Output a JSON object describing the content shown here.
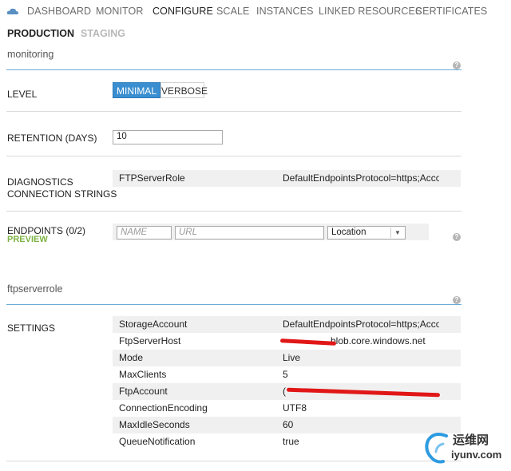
{
  "nav": {
    "items": [
      {
        "label": "DASHBOARD"
      },
      {
        "label": "MONITOR"
      },
      {
        "label": "CONFIGURE"
      },
      {
        "label": "SCALE"
      },
      {
        "label": "INSTANCES"
      },
      {
        "label": "LINKED RESOURCES"
      },
      {
        "label": "CERTIFICATES"
      }
    ],
    "active": "CONFIGURE"
  },
  "environments": {
    "production": "PRODUCTION",
    "staging": "STAGING"
  },
  "monitoring": {
    "title": "monitoring",
    "level": {
      "label": "LEVEL",
      "options": [
        "MINIMAL",
        "VERBOSE"
      ],
      "selected": "MINIMAL"
    },
    "retention": {
      "label": "RETENTION (DAYS)",
      "value": "10"
    },
    "diagnostics": {
      "label_line1": "DIAGNOSTICS",
      "label_line2": "CONNECTION STRINGS",
      "role": "FTPServerRole",
      "value": "DefaultEndpointsProtocol=https;Acco"
    },
    "endpoints": {
      "label": "ENDPOINTS (0/2)",
      "preview": "PREVIEW",
      "name_placeholder": "NAME",
      "url_placeholder": "URL",
      "location": "Location"
    }
  },
  "role": {
    "title": "ftpserverrole",
    "settings_label": "SETTINGS",
    "settings": [
      {
        "key": "StorageAccount",
        "value": "DefaultEndpointsProtocol=https;Acco"
      },
      {
        "key": "FtpServerHost",
        "value": "blob.core.windows.net"
      },
      {
        "key": "Mode",
        "value": "Live"
      },
      {
        "key": "MaxClients",
        "value": "5"
      },
      {
        "key": "FtpAccount",
        "value": "("
      },
      {
        "key": "ConnectionEncoding",
        "value": "UTF8"
      },
      {
        "key": "MaxIdleSeconds",
        "value": "60"
      },
      {
        "key": "QueueNotification",
        "value": "true"
      }
    ]
  },
  "watermark": {
    "line1": "运维网",
    "line2": "iyunv.com"
  },
  "colors": {
    "accent": "#3b8fd1",
    "section_line": "#6aaad6",
    "preview": "#7cb342",
    "redaction": "#e11717"
  }
}
